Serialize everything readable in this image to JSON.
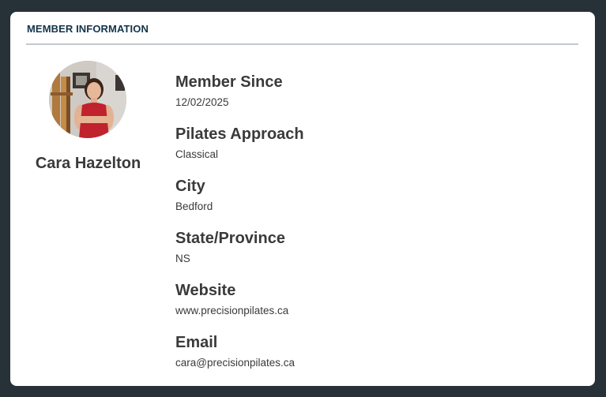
{
  "card": {
    "title": "MEMBER INFORMATION"
  },
  "profile": {
    "name": "Cara Hazelton",
    "avatar_icon": "member-photo"
  },
  "fields": [
    {
      "label": "Member Since",
      "value": "12/02/2025"
    },
    {
      "label": "Pilates Approach",
      "value": "Classical"
    },
    {
      "label": "City",
      "value": "Bedford"
    },
    {
      "label": "State/Province",
      "value": "NS"
    },
    {
      "label": "Website",
      "value": "www.precisionpilates.ca"
    },
    {
      "label": "Email",
      "value": "cara@precisionpilates.ca"
    }
  ],
  "colors": {
    "page_background": "#263238",
    "card_background": "#ffffff",
    "title_color": "#14344a",
    "divider_color": "#c3c9cf",
    "text_color": "#3a3a3a"
  }
}
